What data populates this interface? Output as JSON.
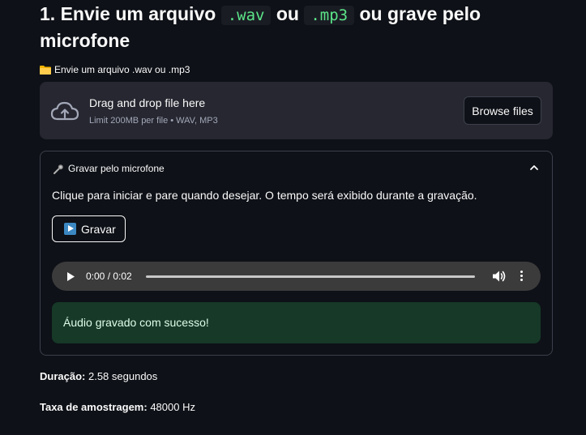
{
  "heading": {
    "part1": "1. Envie um arquivo",
    "code1": ".wav",
    "part2": "ou",
    "code2": ".mp3",
    "part3": "ou grave pelo microfone"
  },
  "uploader": {
    "icon": "folder-icon",
    "label": "Envie um arquivo .wav ou .mp3",
    "drop_title": "Drag and drop file here",
    "drop_subtitle": "Limit 200MB per file • WAV, MP3",
    "browse_label": "Browse files"
  },
  "recorder": {
    "icon": "microphone-icon",
    "title": "Gravar pelo microfone",
    "expanded": true,
    "instructions": "Clique para iniciar e pare quando desejar. O tempo será exibido durante a gravação.",
    "record_label": "Gravar",
    "audio": {
      "time": "0:00 / 0:02",
      "progress": 0
    },
    "success_message": "Áudio gravado com sucesso!"
  },
  "stats": {
    "duration_label": "Duração:",
    "duration_value": "2.58 segundos",
    "sample_rate_label": "Taxa de amostragem:",
    "sample_rate_value": "48000 Hz"
  },
  "colors": {
    "background": "#0e1117",
    "surface": "#262730",
    "code_green": "#5ce488",
    "success_bg": "#173928"
  }
}
